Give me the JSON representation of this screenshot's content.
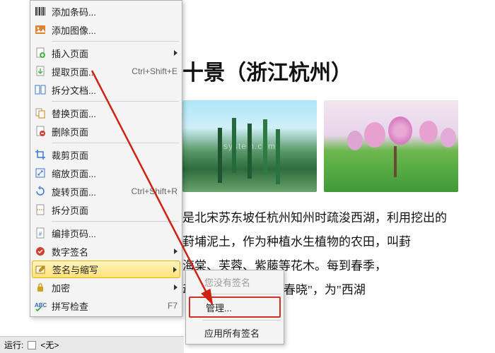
{
  "menu": {
    "items": [
      {
        "label": "添加条码...",
        "icon": "barcode-icon"
      },
      {
        "label": "添加图像...",
        "icon": "image-icon"
      }
    ],
    "group2": [
      {
        "label": "插入页面",
        "icon": "insert-page-icon",
        "arrow": true
      },
      {
        "label": "提取页面...",
        "icon": "extract-page-icon",
        "shortcut": "Ctrl+Shift+E"
      },
      {
        "label": "拆分文档...",
        "icon": "split-doc-icon"
      }
    ],
    "group3": [
      {
        "label": "替换页面...",
        "icon": "replace-page-icon"
      },
      {
        "label": "删除页面",
        "icon": "delete-page-icon"
      }
    ],
    "group4": [
      {
        "label": "裁剪页面",
        "icon": "crop-page-icon"
      },
      {
        "label": "缩放页面...",
        "icon": "scale-page-icon"
      },
      {
        "label": "旋转页面...",
        "icon": "rotate-page-icon",
        "shortcut": "Ctrl+Shift+R"
      },
      {
        "label": "拆分页面",
        "icon": "split-page-icon"
      }
    ],
    "group5": [
      {
        "label": "编排页码...",
        "icon": "page-number-icon"
      },
      {
        "label": "数字签名",
        "icon": "digital-sign-icon",
        "arrow": true
      },
      {
        "label": "签名与缩写",
        "icon": "signature-icon",
        "arrow": true,
        "highlight": true
      },
      {
        "label": "加密",
        "icon": "encrypt-icon",
        "arrow": true
      },
      {
        "label": "拼写检查",
        "icon": "spellcheck-icon",
        "shortcut": "F7"
      }
    ]
  },
  "submenu": {
    "disabled": "您没有签名",
    "manage": "管理...",
    "apply_all": "应用所有签名"
  },
  "document": {
    "title": "十景（浙江杭州）",
    "watermark": "system.com",
    "body_lines": [
      "是北宋苏东坡任杭州知州时疏浚西湖，利用挖出的",
      "葑埔泥土，作为种植水生植物的农田，叫葑",
      "海棠、芙蓉、紫藤等花木。每到春季，",
      "动人，故称为\"苏堤春晓\"，为\"西湖"
    ]
  },
  "statusbar": {
    "run_label": "运行:",
    "value": "<无>"
  },
  "icons": {
    "barcode": "#555",
    "image": "#d06000",
    "page_green": "#3a9a3a",
    "page_blue": "#2a6bd0",
    "abc": "#2a6bd0",
    "sign": "#b06a00"
  }
}
